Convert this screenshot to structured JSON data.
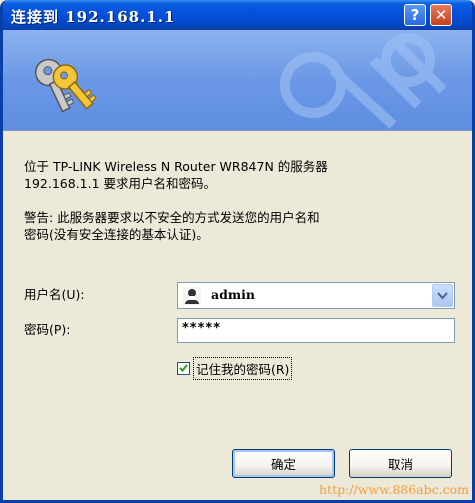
{
  "window": {
    "title": "连接到 192.168.1.1",
    "help_label": "?",
    "close_label": "✕"
  },
  "message": {
    "line1": "位于 TP-LINK Wireless N Router WR847N 的服务器",
    "line2": "192.168.1.1 要求用户名和密码。",
    "warning_line1": "警告: 此服务器要求以不安全的方式发送您的用户名和",
    "warning_line2": "密码(没有安全连接的基本认证)。"
  },
  "form": {
    "username_label": "用户名(U):",
    "username_value": "admin",
    "password_label": "密码(P):",
    "password_value": "*****",
    "remember_label": "记住我的密码(R)",
    "remember_checked": true
  },
  "buttons": {
    "ok_label": "确定",
    "cancel_label": "取消"
  },
  "watermark": "http://www.886abc.com",
  "colors": {
    "titlebar": "#0550dd",
    "banner": "#6b98e6",
    "dialog_bg": "#ece9d8",
    "checkmark": "#21a121"
  },
  "icons": {
    "banner": "keys-icon",
    "user": "user-account-icon",
    "dropdown": "chevron-down-icon",
    "checkbox": "check-icon"
  }
}
